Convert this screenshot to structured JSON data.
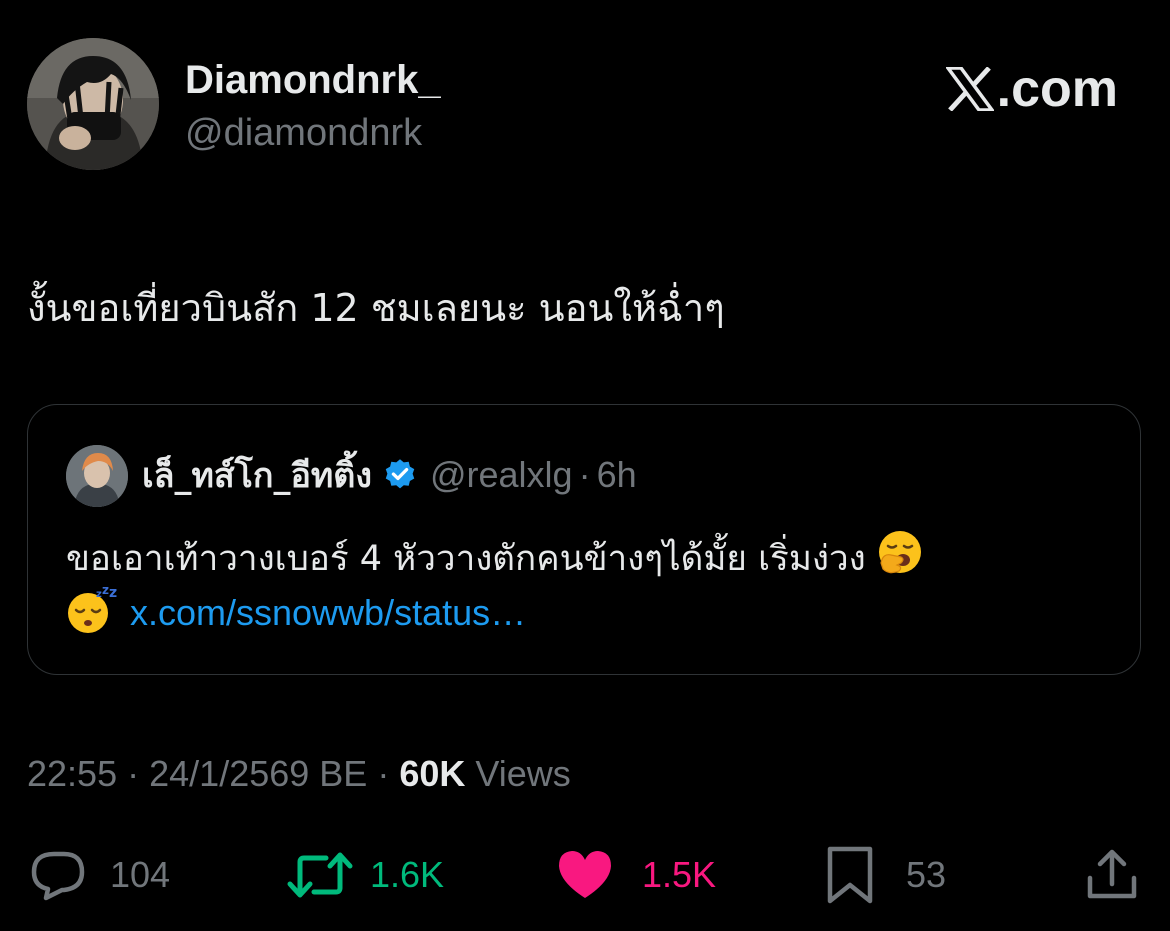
{
  "author": {
    "display_name": "Diamondnrk_",
    "handle": "@diamondnrk"
  },
  "brand": {
    "text": ".com"
  },
  "tweet": {
    "text": "งั้นขอเที่ยวบินสัก 12 ชมเลยนะ นอนให้ฉ่ำๆ"
  },
  "quote": {
    "display_name": "เล็_ทส์โก_อีทติ้ง",
    "handle": "@realxlg",
    "separator": "·",
    "time": "6h",
    "text_line1": "ขอเอาเท้าวางเบอร์ 4 หัววางตักคนข้างๆได้มั้ย เริ่มง่วง",
    "link": "x.com/ssnowwb/status…",
    "emoji_line1": "yawning-face",
    "emoji_line2": "sleeping-face"
  },
  "meta": {
    "time": "22:55",
    "separator": "·",
    "date": "24/1/2569 BE",
    "views_count": "60K",
    "views_label": "Views"
  },
  "actions": {
    "replies": "104",
    "reposts": "1.6K",
    "likes": "1.5K",
    "bookmarks": "53"
  },
  "colors": {
    "background": "#000000",
    "text": "#e7e9ea",
    "muted": "#71767b",
    "link": "#1d9bf0",
    "repost": "#00ba7c",
    "like": "#f91880",
    "border": "#2f3336"
  }
}
